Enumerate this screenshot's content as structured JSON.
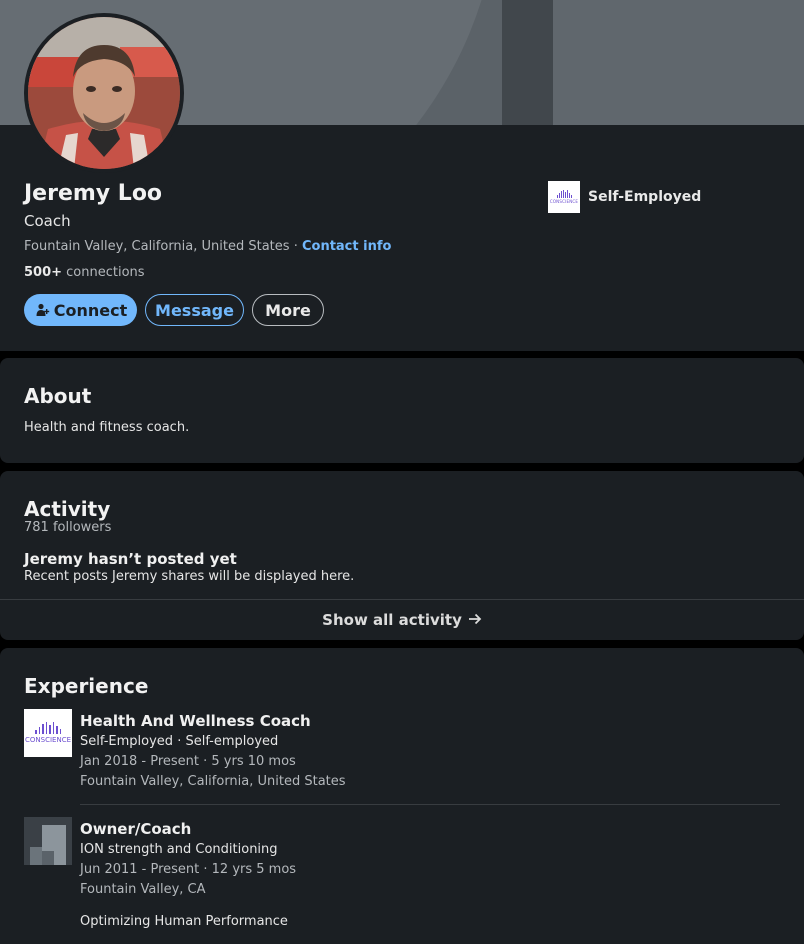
{
  "profile": {
    "name": "Jeremy Loo",
    "headline": "Coach",
    "location": "Fountain Valley, California, United States",
    "separator": " · ",
    "contact_info": "Contact info",
    "connections_count": "500+",
    "connections_label": " connections",
    "current_company": "Self-Employed"
  },
  "actions": {
    "connect": "Connect",
    "message": "Message",
    "more": "More"
  },
  "logo_text": "CONSCIENCE",
  "about": {
    "title": "About",
    "text": "Health and fitness coach."
  },
  "activity": {
    "title": "Activity",
    "followers": "781 followers",
    "empty_title": "Jeremy hasn’t posted yet",
    "empty_subtitle": "Recent posts Jeremy shares will be displayed here.",
    "show_all": "Show all activity"
  },
  "experience": {
    "title": "Experience",
    "items": [
      {
        "role": "Health And Wellness Coach",
        "company": "Self-Employed · Self-employed",
        "dates": "Jan 2018 - Present · 5 yrs 10 mos",
        "location": "Fountain Valley, California, United States"
      },
      {
        "role": "Owner/Coach",
        "company": "ION strength and Conditioning",
        "dates": "Jun 2011 - Present · 12 yrs 5 mos",
        "location": "Fountain Valley, CA",
        "description": "Optimizing Human Performance"
      }
    ]
  },
  "colors": {
    "accent": "#71b7fb",
    "card": "#1b1f23",
    "page": "#000000"
  }
}
